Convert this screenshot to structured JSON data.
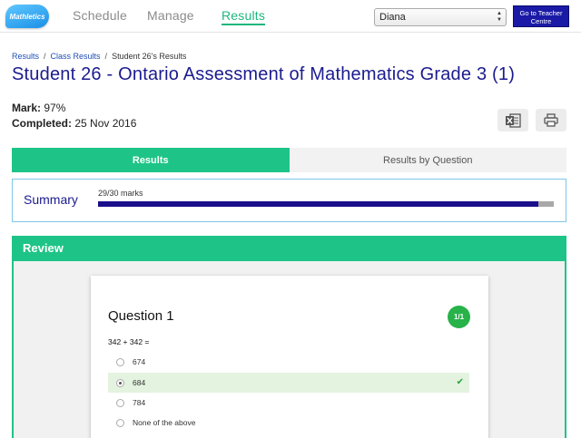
{
  "app": {
    "logo_text": "Mathletics"
  },
  "nav": {
    "items": [
      {
        "label": "Schedule",
        "active": false
      },
      {
        "label": "Manage",
        "active": false
      },
      {
        "label": "Results",
        "active": true
      }
    ],
    "student_select": {
      "value": "Diana"
    },
    "teacher_centre_button": "Go to Teacher Centre"
  },
  "breadcrumb": [
    "Results",
    "Class Results",
    "Student 26's Results"
  ],
  "page_title": "Student 26 - Ontario Assessment of Mathematics Grade 3 (1)",
  "meta": {
    "mark_label": "Mark:",
    "mark_value": "97%",
    "completed_label": "Completed:",
    "completed_value": "25 Nov 2016"
  },
  "actions": {
    "excel_icon": "excel-export-icon",
    "print_icon": "print-icon"
  },
  "tabs": [
    {
      "label": "Results",
      "active": true
    },
    {
      "label": "Results by Question",
      "active": false
    }
  ],
  "summary": {
    "label": "Summary",
    "marks_text": "29/30 marks",
    "progress_fraction": 0.967
  },
  "review": {
    "header": "Review",
    "question": {
      "title": "Question 1",
      "score": "1/1",
      "prompt": "342 + 342 =",
      "options": [
        {
          "label": "674",
          "selected": false
        },
        {
          "label": "684",
          "selected": true,
          "correct": true
        },
        {
          "label": "784",
          "selected": false
        },
        {
          "label": "None of the above",
          "selected": false
        }
      ]
    }
  },
  "colors": {
    "brand_green": "#1ec487",
    "title_blue": "#1b1b8f",
    "progress_fill": "#1a0f8a",
    "teacher_button": "#1a1aa6"
  }
}
